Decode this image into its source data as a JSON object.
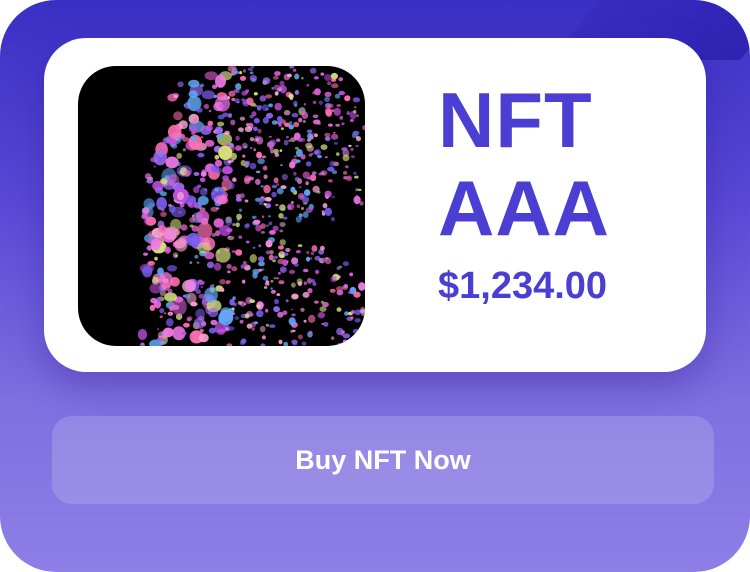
{
  "card": {
    "title_line1": "NFT",
    "title_line2": "AAA",
    "price": "$1,234.00",
    "image_alt": "Abstract portrait artwork made of colorful dots"
  },
  "actions": {
    "buy_label": "Buy NFT Now"
  },
  "colors": {
    "accent": "#4a3fd2",
    "background_top": "#3a2fc4",
    "background_bottom": "#8d7fe6",
    "card": "#ffffff"
  }
}
